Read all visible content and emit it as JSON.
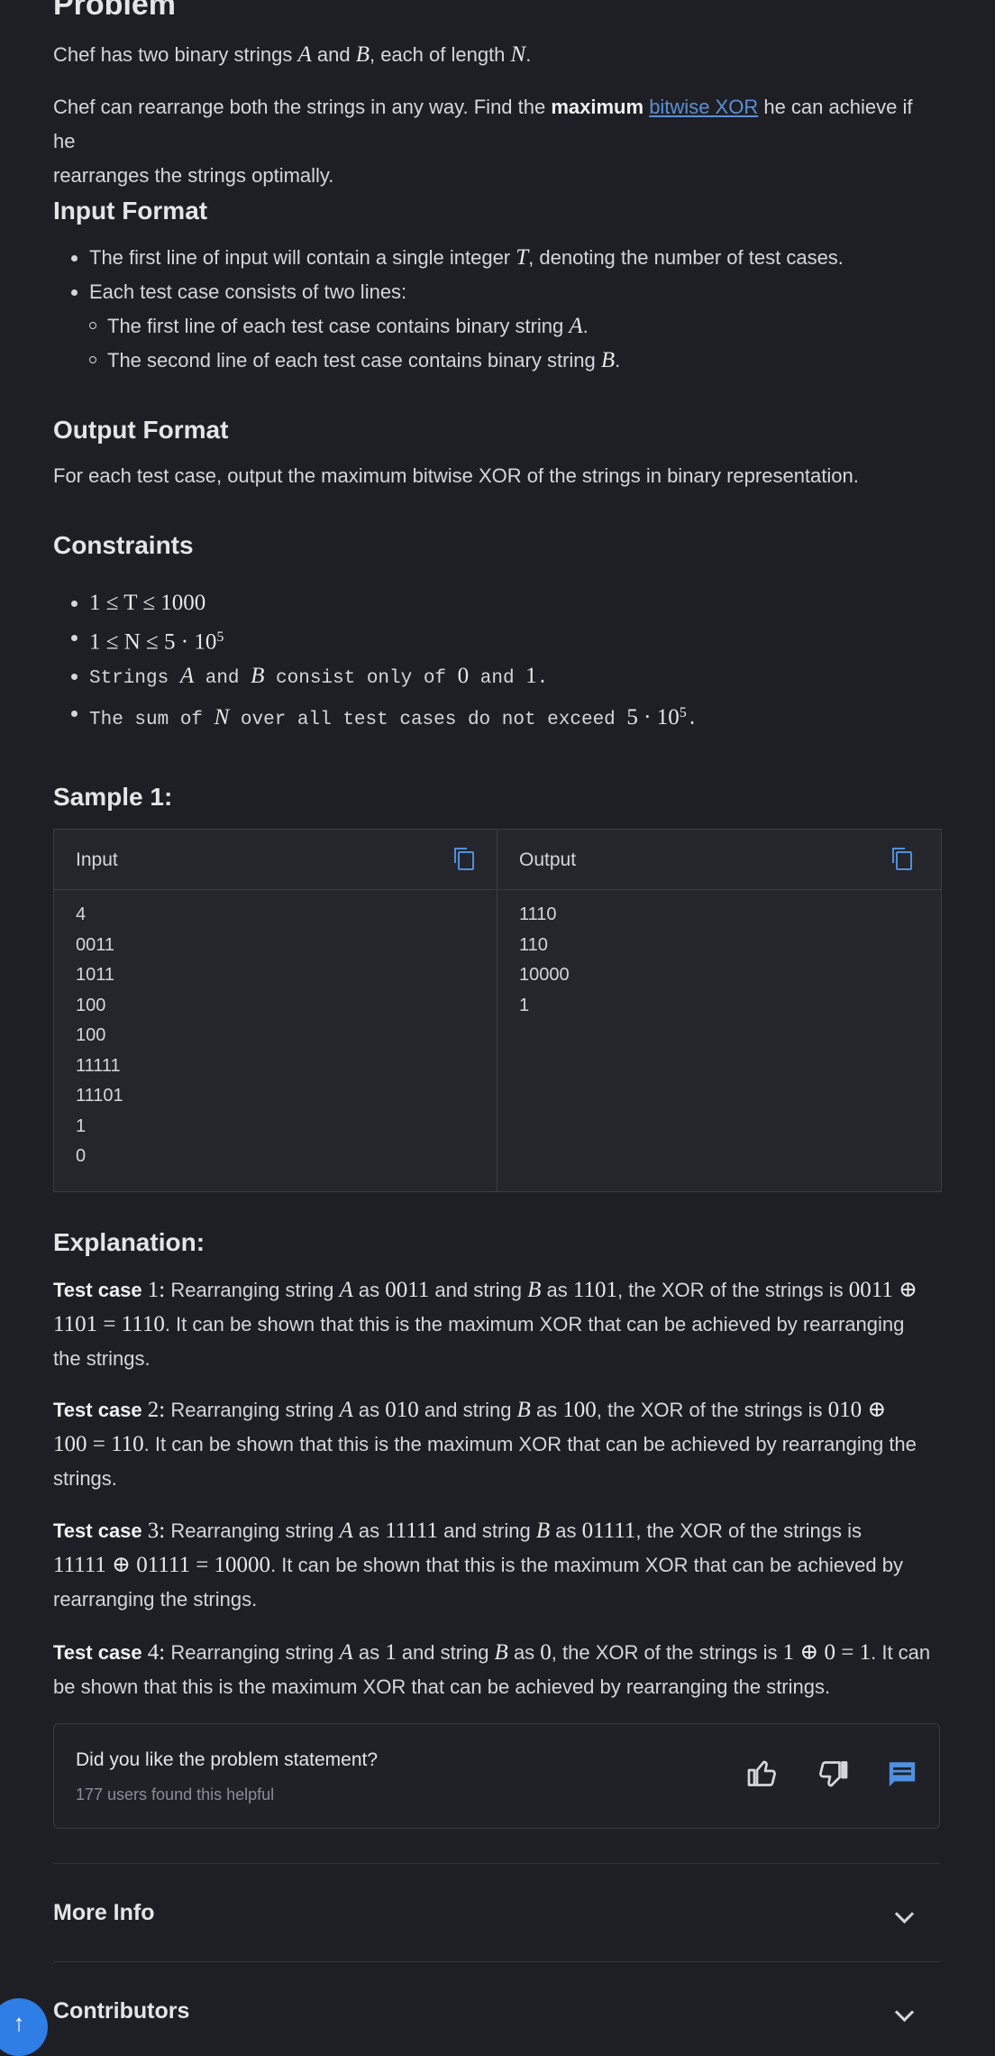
{
  "problem": {
    "title": "Problem",
    "intro": {
      "pre": "Chef has two binary strings ",
      "A": "A",
      "and": " and ",
      "B": "B",
      "post": ", each of length ",
      "N": "N",
      "end": "."
    },
    "task": {
      "pre": "Chef can rearrange both the strings in any way. Find the ",
      "bold": "maximum",
      "link": "bitwise XOR",
      "post1": " he can achieve if he",
      "post2": "rearranges the strings optimally."
    }
  },
  "input_format": {
    "heading": "Input Format",
    "items": [
      {
        "pre": "The first line of input will contain a single integer ",
        "var": "T",
        "post": ", denoting the number of test cases."
      },
      {
        "text": "Each test case consists of two lines:"
      }
    ],
    "subitems": [
      {
        "pre": "The first line of each test case contains binary string ",
        "var": "A",
        "post": "."
      },
      {
        "pre": "The second line of each test case contains binary string ",
        "var": "B",
        "post": "."
      }
    ]
  },
  "output_format": {
    "heading": "Output Format",
    "text": "For each test case, output the maximum bitwise XOR of the strings in binary representation."
  },
  "constraints": {
    "heading": "Constraints",
    "c1": "1 ≤ T ≤ 1000",
    "c2_pre": "1 ≤ N ≤ 5 · 10",
    "c2_sup": "5",
    "c3_a": "Strings ",
    "c3_A": "A",
    "c3_b": " and ",
    "c3_B": "B",
    "c3_c": " consist only of ",
    "c3_0": "0",
    "c3_d": " and ",
    "c3_1": "1",
    "c3_e": ".",
    "c4_a": "The sum of ",
    "c4_N": "N",
    "c4_b": " over all test cases do not exceed ",
    "c4_val": "5 · 10",
    "c4_sup": "5",
    "c4_end": "."
  },
  "sample": {
    "heading": "Sample 1:",
    "input_label": "Input",
    "output_label": "Output",
    "input_lines": [
      "4",
      "0011",
      "1011",
      "100",
      "100",
      "11111",
      "11101",
      "1",
      "0"
    ],
    "output_lines": [
      "1110",
      "110",
      "10000",
      "1"
    ]
  },
  "explanation": {
    "heading": "Explanation:",
    "tc_label": "Test case",
    "cases": [
      {
        "n": "1:",
        "pre": " Rearranging string ",
        "A": "A",
        "as": " as ",
        "a": "0011",
        "and": " and string ",
        "B": "B",
        "b": "1101",
        "xor_pre": ", the XOR of the strings is ",
        "l1_end": "0011 ⊕",
        "l2_expr": "1101 = 1110",
        "l2_text": ". It can be shown that this is the maximum XOR that can be achieved by rearranging",
        "l3": "the strings."
      },
      {
        "n": "2:",
        "pre": " Rearranging string ",
        "A": "A",
        "as": " as ",
        "a": "010",
        "and": " and string ",
        "B": "B",
        "b": "100",
        "xor_pre": ", the XOR of the strings is ",
        "l1_end": "010 ⊕",
        "l2_expr": "100 = 110",
        "l2_text": ". It can be shown that this is the maximum XOR that can be achieved by rearranging the",
        "l3": "strings."
      },
      {
        "n": "3:",
        "pre": " Rearranging string ",
        "A": "A",
        "as": " as ",
        "a": "11111",
        "and": " and string ",
        "B": "B",
        "b": "01111",
        "xor_pre": ", the XOR of the strings is",
        "l1_end": "",
        "l2_expr": "11111 ⊕ 01111 = 10000",
        "l2_text": ". It can be shown that this is the maximum XOR that can be achieved by",
        "l3": "rearranging the strings."
      },
      {
        "n": "4:",
        "pre": " Rearranging string ",
        "A": "A",
        "as": " as ",
        "a": "1",
        "and": " and string ",
        "B": "B",
        "b": "0",
        "xor_pre": ", the XOR of the strings is ",
        "l1_end": "1 ⊕ 0 = 1",
        "l1_tail": ". It can",
        "l2_text": "be shown that this is the maximum XOR that can be achieved by rearranging the strings."
      }
    ]
  },
  "feedback": {
    "question": "Did you like the problem statement?",
    "count": "177 users found this helpful",
    "like_icon": "thumbs-up-icon",
    "dislike_icon": "thumbs-down-icon",
    "comment_icon": "comment-icon",
    "accent": "#4f8fde"
  },
  "sections": {
    "more_info": "More Info",
    "contributors": "Contributors"
  },
  "scroll_top_icon": "↑"
}
